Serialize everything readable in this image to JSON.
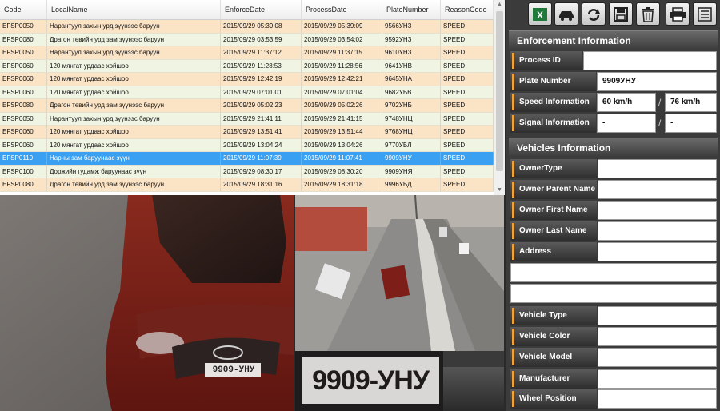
{
  "table": {
    "columns": [
      "Code",
      "LocalName",
      "EnforceDate",
      "ProcessDate",
      "PlateNumber",
      "ReasonCode"
    ],
    "rows": [
      [
        "EFSP0050",
        "Нарантуул захын урд зүүнээс баруун",
        "2015/09/29 05:39:08",
        "2015/09/29 05:39:09",
        "9566УНЗ",
        "SPEED"
      ],
      [
        "EFSP0080",
        "Драгон төвийн урд зам зүүнээс баруун",
        "2015/09/29 03:53:59",
        "2015/09/29 03:54:02",
        "9592УНЗ",
        "SPEED"
      ],
      [
        "EFSP0050",
        "Нарантуул захын урд зүүнээс баруун",
        "2015/09/29 11:37:12",
        "2015/09/29 11:37:15",
        "9610УНЗ",
        "SPEED"
      ],
      [
        "EFSP0060",
        "120 мянгат урдаас хойшоо",
        "2015/09/29 11:28:53",
        "2015/09/29 11:28:56",
        "9641УНВ",
        "SPEED"
      ],
      [
        "EFSP0060",
        "120 мянгат урдаас хойшоо",
        "2015/09/29 12:42:19",
        "2015/09/29 12:42:21",
        "9645УНА",
        "SPEED"
      ],
      [
        "EFSP0060",
        "120 мянгат урдаас хойшоо",
        "2015/09/29 07:01:01",
        "2015/09/29 07:01:04",
        "9682УБВ",
        "SPEED"
      ],
      [
        "EFSP0080",
        "Драгон төвийн урд зам зүүнээс баруун",
        "2015/09/29 05:02:23",
        "2015/09/29 05:02:26",
        "9702УНБ",
        "SPEED"
      ],
      [
        "EFSP0050",
        "Нарантуул захын урд зүүнээс баруун",
        "2015/09/29 21:41:11",
        "2015/09/29 21:41:15",
        "9748УНЦ",
        "SPEED"
      ],
      [
        "EFSP0060",
        "120 мянгат урдаас хойшоо",
        "2015/09/29 13:51:41",
        "2015/09/29 13:51:44",
        "9768УНЦ",
        "SPEED"
      ],
      [
        "EFSP0060",
        "120 мянгат урдаас хойшоо",
        "2015/09/29 13:04:24",
        "2015/09/29 13:04:26",
        "9770УБЛ",
        "SPEED"
      ],
      [
        "EFSP0110",
        "Нарны зам баруунаас зүүн",
        "2015/09/29 11:07:39",
        "2015/09/29 11:07:41",
        "9909УНУ",
        "SPEED"
      ],
      [
        "EFSP0100",
        "Доржийн гудамж баруунаас зүүн",
        "2015/09/29 08:30:17",
        "2015/09/29 08:30:20",
        "9909УНЯ",
        "SPEED"
      ],
      [
        "EFSP0080",
        "Драгон төвийн урд зам зүүнээс баруун",
        "2015/09/29 18:31:16",
        "2015/09/29 18:31:18",
        "9996УБД",
        "SPEED"
      ]
    ],
    "selected_row": 10
  },
  "images": {
    "plate_text": "9909-УНУ",
    "plate_closeup_text": "9909-УНУ"
  },
  "toolbar": {
    "icons": [
      "excel-icon",
      "car-icon",
      "refresh-icon",
      "save-icon",
      "delete-icon",
      "printer-icon",
      "list-icon"
    ]
  },
  "enforcement": {
    "title": "Enforcement Information",
    "process_id_label": "Process ID",
    "process_id_value": "",
    "plate_number_label": "Plate Number",
    "plate_number_value": "9909УНУ",
    "speed_label": "Speed Information",
    "speed_value": "60 km/h",
    "speed_limit_value": "76 km/h",
    "signal_label": "Signal Information",
    "signal_value_1": "-",
    "signal_value_2": "-"
  },
  "vehicles": {
    "title": "Vehicles Information",
    "owner_type_label": "OwnerType",
    "owner_parent_name_label": "Owner Parent Name",
    "owner_first_name_label": "Owner First Name",
    "owner_last_name_label": "Owner Last Name",
    "address_label": "Address",
    "vehicle_type_label": "Vehicle Type",
    "vehicle_color_label": "Vehicle Color",
    "vehicle_model_label": "Vehicle Model",
    "manufacturer_label": "Manufacturer",
    "wheel_position_label": "Wheel Position"
  },
  "colors": {
    "row_odd": "#fbe3c6",
    "row_even": "#f0f5e3",
    "row_selected": "#3aa0f2",
    "accent": "#f0a23a"
  }
}
